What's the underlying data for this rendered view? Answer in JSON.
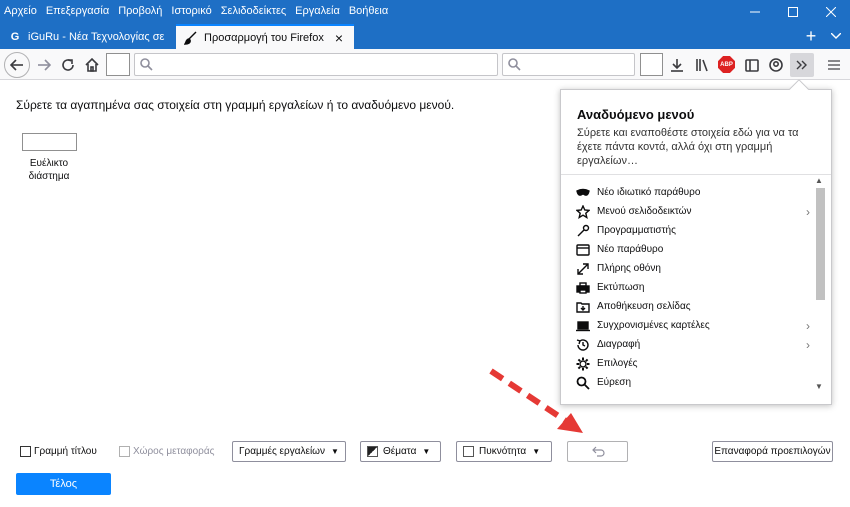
{
  "menubar": [
    "Αρχείο",
    "Επεξεργασία",
    "Προβολή",
    "Ιστορικό",
    "Σελιδοδείκτες",
    "Εργαλεία",
    "Βοήθεια"
  ],
  "tabs": [
    {
      "title": "iGuRu - Νέα Τεχνολογίας σε πρ",
      "favicon": "G",
      "active": false
    },
    {
      "title": "Προσαρμογή του Firefox",
      "favicon": "paintbrush-icon",
      "active": true
    }
  ],
  "content": {
    "heading": "Σύρετε τα αγαπημένα σας στοιχεία στη γραμμή εργαλείων ή το αναδυόμενο μενού.",
    "flex_space_label": "Ευέλικτο διάστημα"
  },
  "panel": {
    "title": "Αναδυόμενο μενού",
    "description": "Σύρετε και εναποθέστε στοιχεία εδώ για να τα έχετε πάντα κοντά, αλλά όχι στη γραμμή εργαλείων…",
    "items": [
      {
        "label": "Νέο ιδιωτικό παράθυρο",
        "icon": "mask-icon",
        "submenu": false
      },
      {
        "label": "Μενού σελιδοδεικτών",
        "icon": "star-icon",
        "submenu": true
      },
      {
        "label": "Προγραμματιστής",
        "icon": "wrench-icon",
        "submenu": false
      },
      {
        "label": "Νέο παράθυρο",
        "icon": "window-icon",
        "submenu": false
      },
      {
        "label": "Πλήρης οθόνη",
        "icon": "fullscreen-icon",
        "submenu": false
      },
      {
        "label": "Εκτύπωση",
        "icon": "printer-icon",
        "submenu": false
      },
      {
        "label": "Αποθήκευση σελίδας",
        "icon": "folder-icon",
        "submenu": false
      },
      {
        "label": "Συγχρονισμένες καρτέλες",
        "icon": "laptop-icon",
        "submenu": true
      },
      {
        "label": "Διαγραφή",
        "icon": "history-icon",
        "submenu": true
      },
      {
        "label": "Επιλογές",
        "icon": "gear-icon",
        "submenu": false
      },
      {
        "label": "Εύρεση",
        "icon": "search-icon",
        "submenu": false
      }
    ]
  },
  "bottom": {
    "title_bar_label": "Γραμμή τίτλου",
    "drag_space_label": "Χώρος μεταφοράς",
    "toolbars_label": "Γραμμές εργαλείων",
    "themes_label": "Θέματα",
    "density_label": "Πυκνότητα",
    "reset_label": "Επαναφορά προεπιλογών",
    "done_label": "Τέλος"
  },
  "colors": {
    "titlebar": "#1e6fc5",
    "accent": "#0a84ff",
    "arrow": "#e53935"
  }
}
